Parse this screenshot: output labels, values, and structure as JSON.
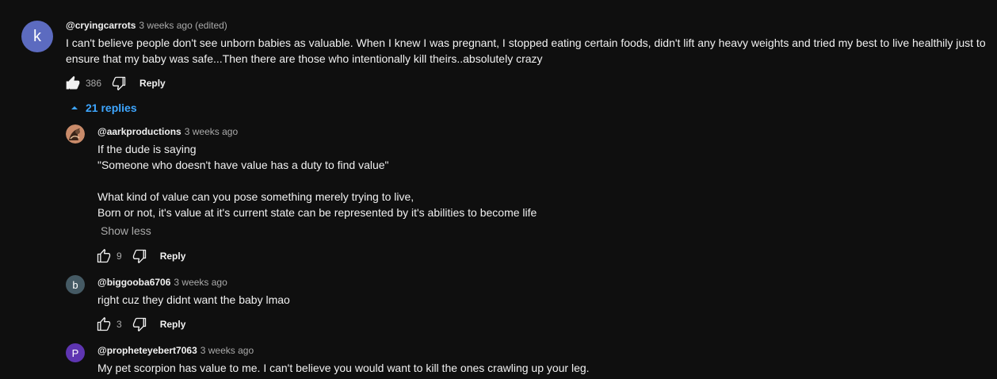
{
  "comment": {
    "avatar_letter": "k",
    "author": "@cryingcarrots",
    "time": "3 weeks ago (edited)",
    "text": "I can't believe people don't see unborn babies as valuable. When I knew I was pregnant, I stopped eating certain foods, didn't lift any heavy weights and tried my best to live healthily just to\nensure that my baby was safe...Then there are those who intentionally kill theirs..absolutely crazy",
    "likes": "386",
    "reply_label": "Reply"
  },
  "replies_toggle": {
    "label": "21 replies",
    "icon": "caret-up-icon",
    "color": "#3ea6ff"
  },
  "replies": [
    {
      "author": "@aarkproductions",
      "time": "3 weeks ago",
      "text": "If the dude is saying\n\"Someone who doesn't have value has a duty to find value\"\n\nWhat kind of value can you pose something merely trying to live,\nBorn or not, it's value at it's current state can be represented by it's abilities to become life",
      "show_less": "Show less",
      "likes": "9",
      "reply_label": "Reply"
    },
    {
      "avatar_letter": "b",
      "author": "@biggooba6706",
      "time": "3 weeks ago",
      "text": "right cuz they didnt want the baby lmao",
      "likes": "3",
      "reply_label": "Reply"
    },
    {
      "avatar_letter": "P",
      "author": "@propheteyebert7063",
      "time": "3 weeks ago",
      "text": "My pet scorpion has value to me.  I can't believe you would want to kill the ones crawling up your leg."
    }
  ],
  "colors": {
    "background": "#0f0f0f",
    "text": "#f1f1f1",
    "secondary_text": "#aaaaaa",
    "link": "#3ea6ff"
  }
}
